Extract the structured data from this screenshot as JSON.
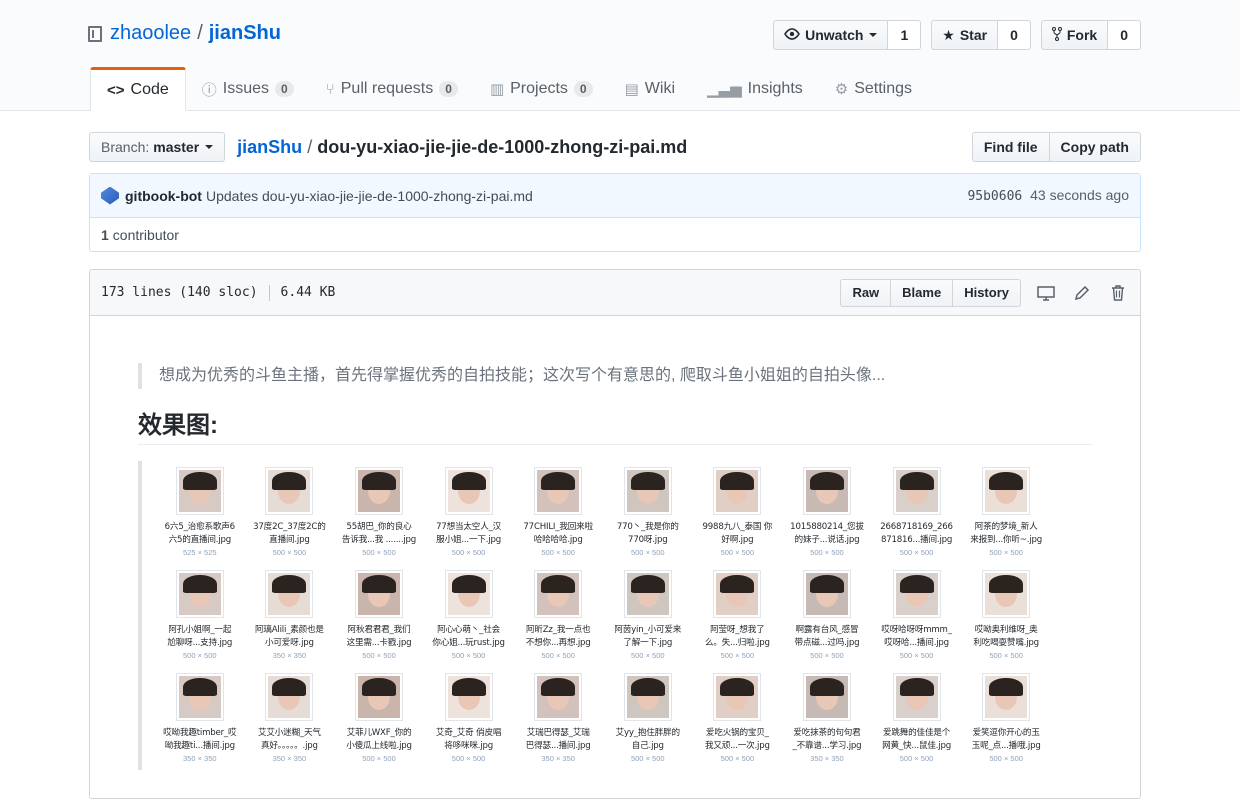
{
  "repo": {
    "owner": "zhaoolee",
    "name": "jianShu"
  },
  "header": {
    "watch": {
      "label": "Unwatch",
      "count": "1"
    },
    "star": {
      "label": "Star",
      "count": "0"
    },
    "fork": {
      "label": "Fork",
      "count": "0"
    }
  },
  "tabs": [
    {
      "label": "Code",
      "counter": null,
      "icon": "code-icon"
    },
    {
      "label": "Issues",
      "counter": "0",
      "icon": "issue-icon"
    },
    {
      "label": "Pull requests",
      "counter": "0",
      "icon": "pull-request-icon"
    },
    {
      "label": "Projects",
      "counter": "0",
      "icon": "project-icon"
    },
    {
      "label": "Wiki",
      "counter": null,
      "icon": "book-icon"
    },
    {
      "label": "Insights",
      "counter": null,
      "icon": "graph-icon"
    },
    {
      "label": "Settings",
      "counter": null,
      "icon": "gear-icon"
    }
  ],
  "file_nav": {
    "branch_prefix": "Branch:",
    "branch": "master",
    "repo_link": "jianShu",
    "filename": "dou-yu-xiao-jie-jie-de-1000-zhong-zi-pai.md",
    "find_file": "Find file",
    "copy_path": "Copy path"
  },
  "commit": {
    "author": "gitbook-bot",
    "message": "Updates dou-yu-xiao-jie-jie-de-1000-zhong-zi-pai.md",
    "sha": "95b0606",
    "time": "43 seconds ago",
    "contributors_count": "1",
    "contributors_label": "contributor"
  },
  "file": {
    "lines": "173 lines (140 sloc)",
    "size": "6.44 KB",
    "raw": "Raw",
    "blame": "Blame",
    "history": "History"
  },
  "readme": {
    "quote": "想成为优秀的斗鱼主播，首先得掌握优秀的自拍技能；这次写个有意思的, 爬取斗鱼小姐姐的自拍头像...",
    "heading": "效果图:"
  },
  "gallery": [
    {
      "caption": "6六5_治愈系歌声6\n六5的直播间.jpg",
      "dim": "525 × 525"
    },
    {
      "caption": "37度2C_37度2C的\n直播间.jpg",
      "dim": "500 × 500"
    },
    {
      "caption": "55胡巴_你的良心\n告诉我...我 .......jpg",
      "dim": "500 × 500"
    },
    {
      "caption": "77想当太空人_汉\n服小姐...一下.jpg",
      "dim": "500 × 500"
    },
    {
      "caption": "77CHILI_我回来啦\n哈哈哈哈.jpg",
      "dim": "500 × 500"
    },
    {
      "caption": "770丶_我是你的\n770呀.jpg",
      "dim": "500 × 500"
    },
    {
      "caption": "9988九八_泰国 你\n好啊.jpg",
      "dim": "500 × 500"
    },
    {
      "caption": "1015880214_您拔\n的妹子...说话.jpg",
      "dim": "500 × 500"
    },
    {
      "caption": "2668718169_266\n871816...播间.jpg",
      "dim": "500 × 500"
    },
    {
      "caption": "阿茶的梦境_新人\n来报到...你听~.jpg",
      "dim": "500 × 500"
    },
    {
      "caption": "阿孔小姐啊_一起\n尬聊呀...支持.jpg",
      "dim": "500 × 500"
    },
    {
      "caption": "阿璃Alili_素颜也是\n小可爱呀.jpg",
      "dim": "350 × 350"
    },
    {
      "caption": "阿秋君君君_我们\n这里需...卡戳.jpg",
      "dim": "500 × 500"
    },
    {
      "caption": "阿心心萌丶_社会\n你心姐...玩rust.jpg",
      "dim": "500 × 500"
    },
    {
      "caption": "阿昕Zz_我一点也\n不想你...再想.jpg",
      "dim": "500 × 500"
    },
    {
      "caption": "阿茵yin_小可爱来\n了解一下.jpg",
      "dim": "500 × 500"
    },
    {
      "caption": "阿莹呀_想我了\n么。失...归啦.jpg",
      "dim": "500 × 500"
    },
    {
      "caption": "啊露有台风_感冒\n带点磁...过吗.jpg",
      "dim": "500 × 500"
    },
    {
      "caption": "哎呀哈呀呀mmm_\n哎呀哈...播间.jpg",
      "dim": "500 × 500"
    },
    {
      "caption": "哎呦奥利维呀_奥\n利吃喝耍赞嘴.jpg",
      "dim": "500 × 500"
    },
    {
      "caption": "哎呦我趣timber_哎\n呦我趣ti...播间.jpg",
      "dim": "350 × 350"
    },
    {
      "caption": "艾艾小迷糊_天气\n真好。。。。。.jpg",
      "dim": "350 × 350"
    },
    {
      "caption": "艾菲儿WXF_你的\n小傻瓜上线啦.jpg",
      "dim": "500 × 500"
    },
    {
      "caption": "艾奇_艾奇  俏皮唱\n将哆咪咪.jpg",
      "dim": "500 × 500"
    },
    {
      "caption": "艾瑞巴得瑟_艾瑞\n巴得瑟...播间.jpg",
      "dim": "350 × 350"
    },
    {
      "caption": "艾yy_抱住胖胖的\n自己.jpg",
      "dim": "500 × 500"
    },
    {
      "caption": "爱吃火锅的宝贝_\n我又顽...一次.jpg",
      "dim": "500 × 500"
    },
    {
      "caption": "爱吃抹茶的句句君\n_不靠谱...学习.jpg",
      "dim": "350 × 350"
    },
    {
      "caption": "爱跳舞的佳佳是个\n网黄_快...鼠佳.jpg",
      "dim": "500 × 500"
    },
    {
      "caption": "爱笑逗你开心的玉\n玉呢_点...播哦.jpg",
      "dim": "500 × 500"
    }
  ],
  "colors": {
    "link": "#0366d6",
    "active_tab": "#e36209",
    "commit_bg": "#f1f8ff"
  }
}
